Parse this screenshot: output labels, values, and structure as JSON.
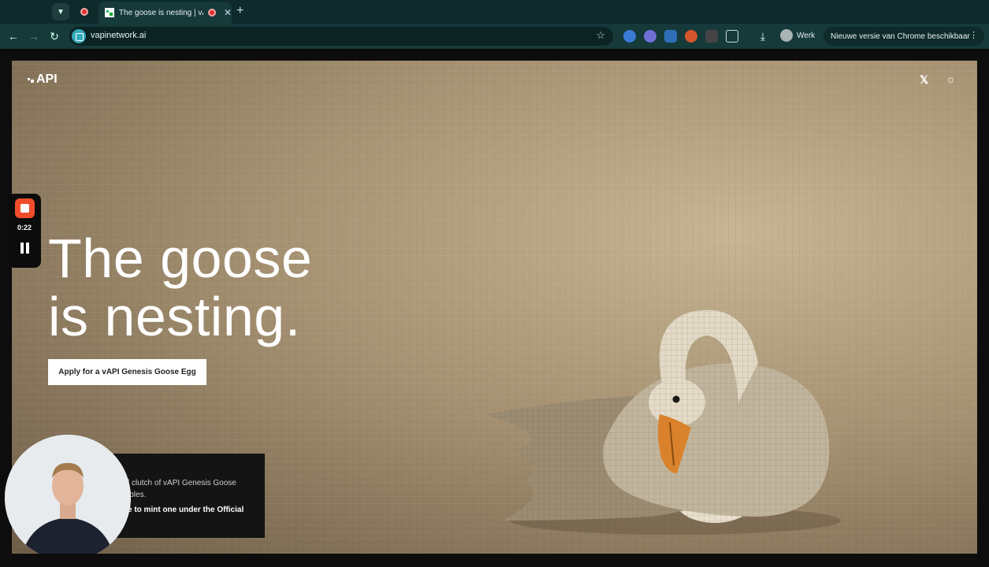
{
  "browser": {
    "tab_title": "The goose is nesting | vAPI",
    "url": "vapinetwork.ai",
    "profile_name": "Werk",
    "update_notice": "Nieuwe versie van Chrome beschikbaar",
    "icons": {
      "tab_menu": "chevron-down-icon",
      "back": "←",
      "forward": "→",
      "reload": "↻",
      "star": "☆",
      "download": "⤓",
      "close": "✕",
      "new_tab": "+",
      "kebab": "⋮"
    }
  },
  "page": {
    "logo": "API",
    "hero_title_line1": "The goose",
    "hero_title_line2": "is nesting.",
    "cta_label": "Apply for a vAPI Genesis Goose Egg",
    "info_line1": "l clutch of vAPI Genesis Goose",
    "info_line2": "ibles.",
    "info_line3": "e to mint one under the Official",
    "x_icon": "𝕏",
    "theme_icon": "☼"
  },
  "recorder": {
    "timer": "0:22"
  },
  "colors": {
    "chrome_bg": "#16393a",
    "tab_strip": "#0e2a2a",
    "record_red": "#f04e2a",
    "beak_orange": "#d9822b"
  }
}
